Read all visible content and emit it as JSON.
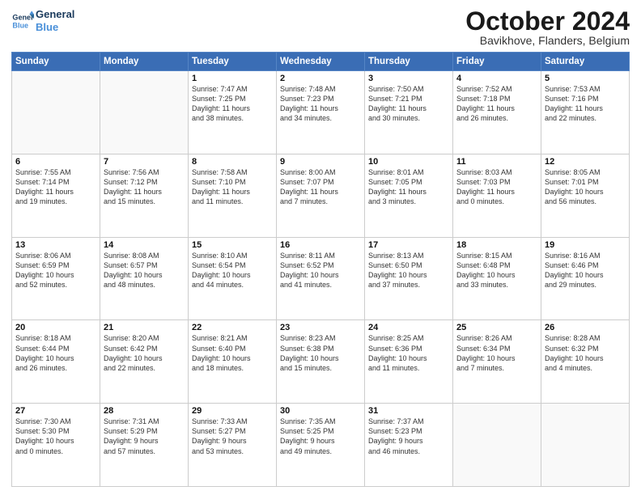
{
  "header": {
    "logo_line1": "General",
    "logo_line2": "Blue",
    "month_title": "October 2024",
    "location": "Bavikhove, Flanders, Belgium"
  },
  "days_of_week": [
    "Sunday",
    "Monday",
    "Tuesday",
    "Wednesday",
    "Thursday",
    "Friday",
    "Saturday"
  ],
  "weeks": [
    [
      {
        "day": "",
        "info": ""
      },
      {
        "day": "",
        "info": ""
      },
      {
        "day": "1",
        "info": "Sunrise: 7:47 AM\nSunset: 7:25 PM\nDaylight: 11 hours\nand 38 minutes."
      },
      {
        "day": "2",
        "info": "Sunrise: 7:48 AM\nSunset: 7:23 PM\nDaylight: 11 hours\nand 34 minutes."
      },
      {
        "day": "3",
        "info": "Sunrise: 7:50 AM\nSunset: 7:21 PM\nDaylight: 11 hours\nand 30 minutes."
      },
      {
        "day": "4",
        "info": "Sunrise: 7:52 AM\nSunset: 7:18 PM\nDaylight: 11 hours\nand 26 minutes."
      },
      {
        "day": "5",
        "info": "Sunrise: 7:53 AM\nSunset: 7:16 PM\nDaylight: 11 hours\nand 22 minutes."
      }
    ],
    [
      {
        "day": "6",
        "info": "Sunrise: 7:55 AM\nSunset: 7:14 PM\nDaylight: 11 hours\nand 19 minutes."
      },
      {
        "day": "7",
        "info": "Sunrise: 7:56 AM\nSunset: 7:12 PM\nDaylight: 11 hours\nand 15 minutes."
      },
      {
        "day": "8",
        "info": "Sunrise: 7:58 AM\nSunset: 7:10 PM\nDaylight: 11 hours\nand 11 minutes."
      },
      {
        "day": "9",
        "info": "Sunrise: 8:00 AM\nSunset: 7:07 PM\nDaylight: 11 hours\nand 7 minutes."
      },
      {
        "day": "10",
        "info": "Sunrise: 8:01 AM\nSunset: 7:05 PM\nDaylight: 11 hours\nand 3 minutes."
      },
      {
        "day": "11",
        "info": "Sunrise: 8:03 AM\nSunset: 7:03 PM\nDaylight: 11 hours\nand 0 minutes."
      },
      {
        "day": "12",
        "info": "Sunrise: 8:05 AM\nSunset: 7:01 PM\nDaylight: 10 hours\nand 56 minutes."
      }
    ],
    [
      {
        "day": "13",
        "info": "Sunrise: 8:06 AM\nSunset: 6:59 PM\nDaylight: 10 hours\nand 52 minutes."
      },
      {
        "day": "14",
        "info": "Sunrise: 8:08 AM\nSunset: 6:57 PM\nDaylight: 10 hours\nand 48 minutes."
      },
      {
        "day": "15",
        "info": "Sunrise: 8:10 AM\nSunset: 6:54 PM\nDaylight: 10 hours\nand 44 minutes."
      },
      {
        "day": "16",
        "info": "Sunrise: 8:11 AM\nSunset: 6:52 PM\nDaylight: 10 hours\nand 41 minutes."
      },
      {
        "day": "17",
        "info": "Sunrise: 8:13 AM\nSunset: 6:50 PM\nDaylight: 10 hours\nand 37 minutes."
      },
      {
        "day": "18",
        "info": "Sunrise: 8:15 AM\nSunset: 6:48 PM\nDaylight: 10 hours\nand 33 minutes."
      },
      {
        "day": "19",
        "info": "Sunrise: 8:16 AM\nSunset: 6:46 PM\nDaylight: 10 hours\nand 29 minutes."
      }
    ],
    [
      {
        "day": "20",
        "info": "Sunrise: 8:18 AM\nSunset: 6:44 PM\nDaylight: 10 hours\nand 26 minutes."
      },
      {
        "day": "21",
        "info": "Sunrise: 8:20 AM\nSunset: 6:42 PM\nDaylight: 10 hours\nand 22 minutes."
      },
      {
        "day": "22",
        "info": "Sunrise: 8:21 AM\nSunset: 6:40 PM\nDaylight: 10 hours\nand 18 minutes."
      },
      {
        "day": "23",
        "info": "Sunrise: 8:23 AM\nSunset: 6:38 PM\nDaylight: 10 hours\nand 15 minutes."
      },
      {
        "day": "24",
        "info": "Sunrise: 8:25 AM\nSunset: 6:36 PM\nDaylight: 10 hours\nand 11 minutes."
      },
      {
        "day": "25",
        "info": "Sunrise: 8:26 AM\nSunset: 6:34 PM\nDaylight: 10 hours\nand 7 minutes."
      },
      {
        "day": "26",
        "info": "Sunrise: 8:28 AM\nSunset: 6:32 PM\nDaylight: 10 hours\nand 4 minutes."
      }
    ],
    [
      {
        "day": "27",
        "info": "Sunrise: 7:30 AM\nSunset: 5:30 PM\nDaylight: 10 hours\nand 0 minutes."
      },
      {
        "day": "28",
        "info": "Sunrise: 7:31 AM\nSunset: 5:29 PM\nDaylight: 9 hours\nand 57 minutes."
      },
      {
        "day": "29",
        "info": "Sunrise: 7:33 AM\nSunset: 5:27 PM\nDaylight: 9 hours\nand 53 minutes."
      },
      {
        "day": "30",
        "info": "Sunrise: 7:35 AM\nSunset: 5:25 PM\nDaylight: 9 hours\nand 49 minutes."
      },
      {
        "day": "31",
        "info": "Sunrise: 7:37 AM\nSunset: 5:23 PM\nDaylight: 9 hours\nand 46 minutes."
      },
      {
        "day": "",
        "info": ""
      },
      {
        "day": "",
        "info": ""
      }
    ]
  ]
}
